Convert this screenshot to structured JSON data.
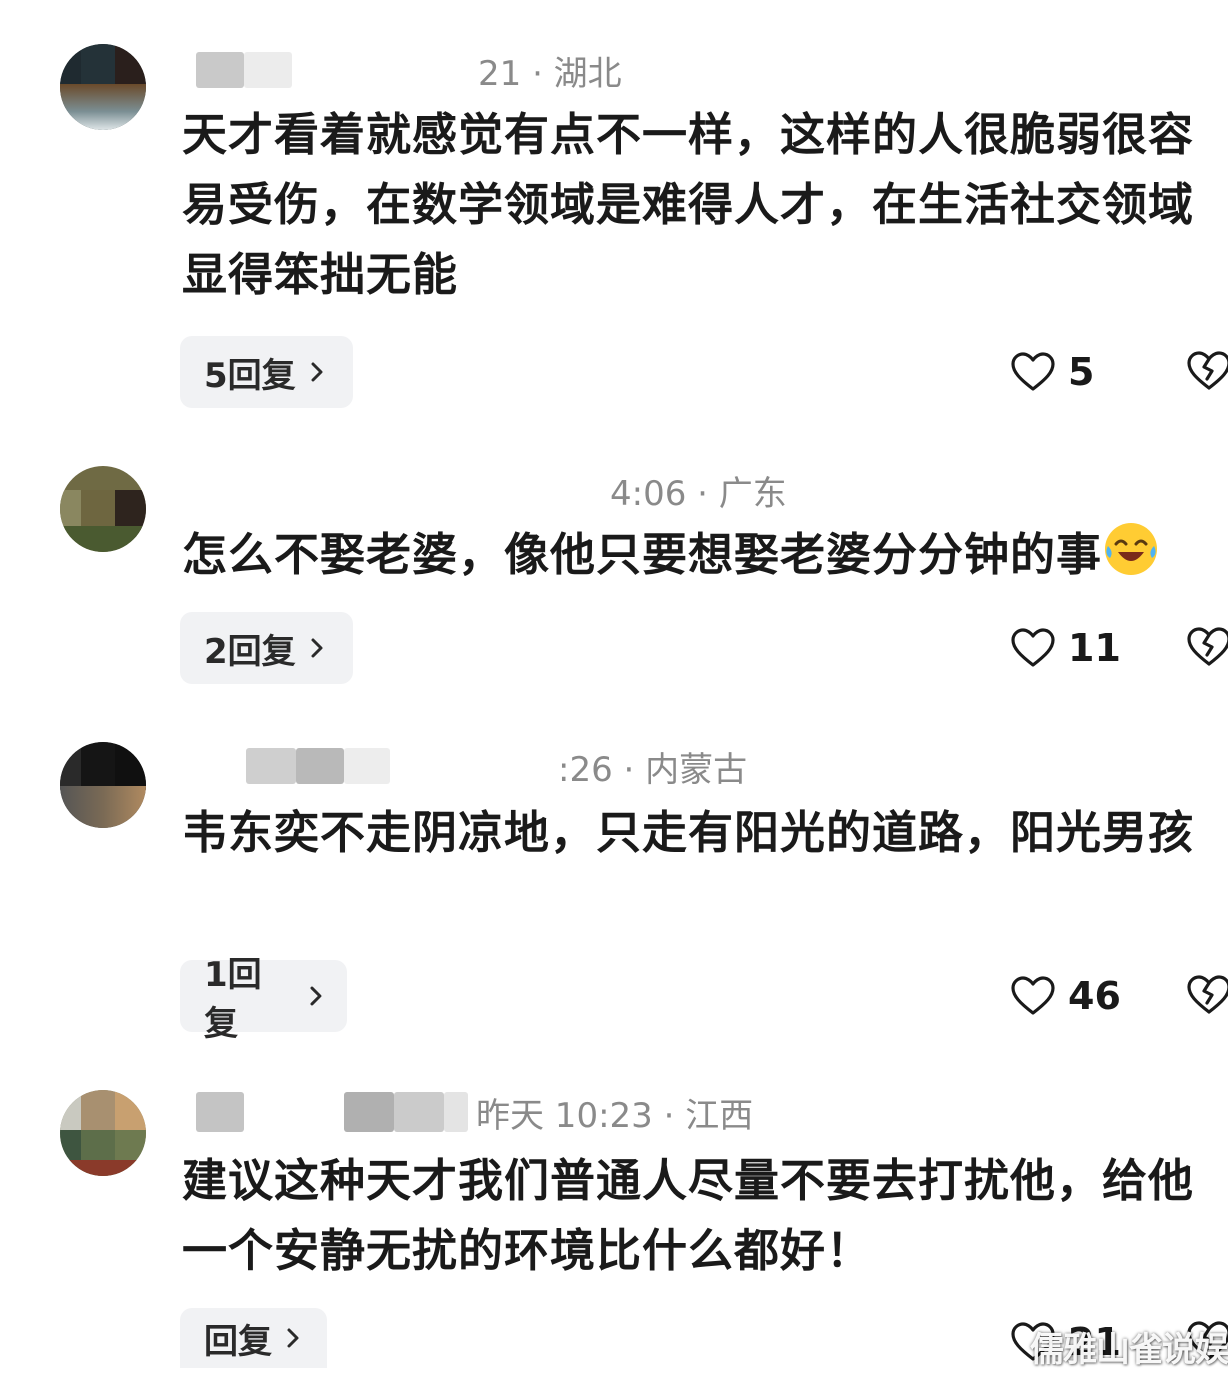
{
  "comments": [
    {
      "meta": "21 · 湖北",
      "content": "天才看着就感觉有点不一样，这样的人很脆弱很容易受伤，在数学领域是难得人才，在生活社交领域显得笨拙无能",
      "reply_label": "5回复",
      "likes": "5"
    },
    {
      "meta": "4:06 · 广东",
      "content": "怎么不娶老婆，像他只要想娶老婆分分钟的事",
      "emoji": "laughing-crying-emoji",
      "reply_label": "2回复",
      "likes": "11"
    },
    {
      "meta": ":26 · 内蒙古",
      "content": "韦东奕不走阴凉地，只走有阳光的道路，阳光男孩",
      "reply_label": "1回复",
      "likes": "46"
    },
    {
      "meta": "昨天 10:23 · 江西",
      "content": "建议这种天才我们普通人尽量不要去打扰他，给他一个安静无扰的环境比什么都好！",
      "reply_label": "回复",
      "likes": "21"
    }
  ],
  "watermark": "儒雅山雀说娱",
  "icons": {
    "like": "heart-outline-icon",
    "dislike": "broken-heart-icon",
    "chevron": "chevron-right-icon"
  },
  "colors": {
    "meta_gray": "#8a8a8a",
    "reply_bg": "#f1f2f4"
  }
}
